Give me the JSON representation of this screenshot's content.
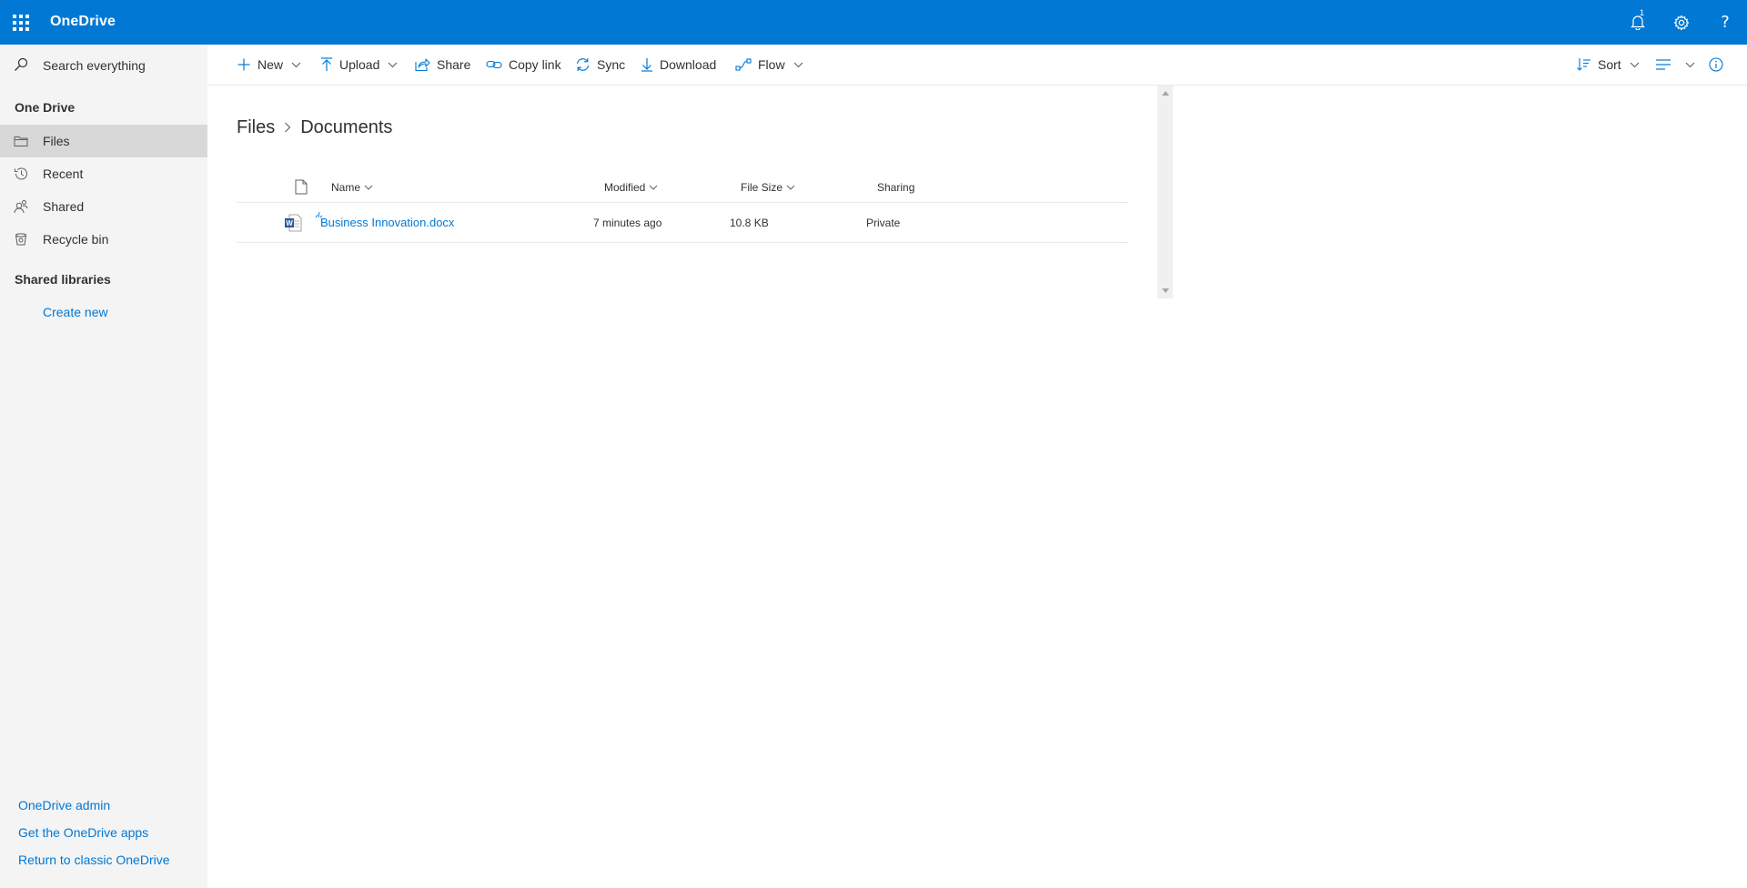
{
  "suite": {
    "brand": "OneDrive",
    "notification_count": "1",
    "help_glyph": "?",
    "accent_color": "#0078d4",
    "icons": [
      "waffle-icon",
      "bell-icon",
      "gear-icon",
      "help-icon"
    ]
  },
  "search": {
    "placeholder": "Search everything"
  },
  "nav": {
    "section_title": "One Drive",
    "items": [
      {
        "label": "Files",
        "icon": "folder-icon",
        "selected": true
      },
      {
        "label": "Recent",
        "icon": "clock-icon"
      },
      {
        "label": "Shared",
        "icon": "people-icon"
      },
      {
        "label": "Recycle bin",
        "icon": "recycle-bin-icon"
      }
    ],
    "shared_libraries_title": "Shared libraries",
    "create_new": "Create new",
    "footer_links": [
      "OneDrive admin",
      "Get the OneDrive apps",
      "Return to classic OneDrive"
    ]
  },
  "commands": {
    "new": "New",
    "upload": "Upload",
    "share": "Share",
    "copy_link": "Copy link",
    "sync": "Sync",
    "download": "Download",
    "flow": "Flow",
    "sort": "Sort"
  },
  "breadcrumb": {
    "root": "Files",
    "current": "Documents"
  },
  "list": {
    "columns": {
      "name": "Name",
      "modified": "Modified",
      "file_size": "File Size",
      "sharing": "Sharing"
    },
    "rows": [
      {
        "name": "Business Innovation.docx",
        "modified": "7 minutes ago",
        "file_size": "10.8 KB",
        "sharing": "Private",
        "icon": "word-doc-icon"
      }
    ]
  }
}
